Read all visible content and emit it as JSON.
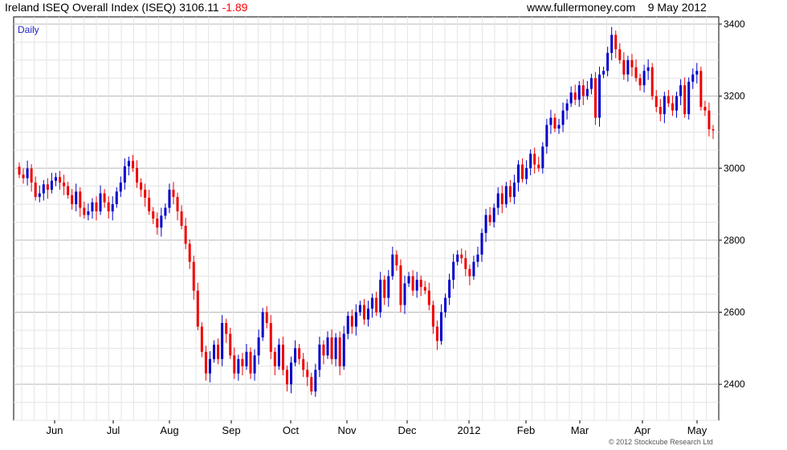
{
  "header": {
    "title": "Ireland ISEQ Overall Index (ISEQ)",
    "last": "3106.11",
    "change": "-1.89",
    "site": "www.fullermoney.com",
    "date": "9 May 2012"
  },
  "period_label": "Daily",
  "credit": "© 2012 Stockcube Research Ltd",
  "colors": {
    "up": "#0000cc",
    "down": "#ee0000",
    "grid": "#cfcfcf",
    "axis": "#000000"
  },
  "chart_data": {
    "type": "candlestick",
    "title": "Ireland ISEQ Overall Index (ISEQ)",
    "x_ticks": [
      "Jun",
      "Jul",
      "Aug",
      "Sep",
      "Oct",
      "Nov",
      "Dec",
      "2012",
      "Feb",
      "Mar",
      "Apr",
      "May"
    ],
    "y_ticks": [
      2400,
      2600,
      2800,
      3000,
      3200,
      3400
    ],
    "ylim": [
      2300,
      3420
    ],
    "grid": true,
    "series": [
      {
        "name": "ISEQ",
        "open_close": [
          [
            3004,
            2982
          ],
          [
            2982,
            2972
          ],
          [
            2972,
            2999
          ],
          [
            2999,
            2960
          ],
          [
            2960,
            2920
          ],
          [
            2920,
            2930
          ],
          [
            2930,
            2955
          ],
          [
            2955,
            2940
          ],
          [
            2940,
            2965
          ],
          [
            2965,
            2975
          ],
          [
            2975,
            2960
          ],
          [
            2960,
            2950
          ],
          [
            2950,
            2925
          ],
          [
            2925,
            2900
          ],
          [
            2900,
            2935
          ],
          [
            2935,
            2890
          ],
          [
            2890,
            2870
          ],
          [
            2870,
            2880
          ],
          [
            2880,
            2905
          ],
          [
            2905,
            2880
          ],
          [
            2880,
            2930
          ],
          [
            2930,
            2905
          ],
          [
            2905,
            2880
          ],
          [
            2880,
            2900
          ],
          [
            2900,
            2935
          ],
          [
            2935,
            2960
          ],
          [
            2960,
            3005
          ],
          [
            3005,
            3020
          ],
          [
            3020,
            3000
          ],
          [
            3000,
            2960
          ],
          [
            2960,
            2940
          ],
          [
            2940,
            2918
          ],
          [
            2918,
            2880
          ],
          [
            2880,
            2860
          ],
          [
            2860,
            2835
          ],
          [
            2835,
            2868
          ],
          [
            2868,
            2890
          ],
          [
            2890,
            2940
          ],
          [
            2940,
            2920
          ],
          [
            2920,
            2880
          ],
          [
            2880,
            2840
          ],
          [
            2840,
            2790
          ],
          [
            2790,
            2740
          ],
          [
            2740,
            2660
          ],
          [
            2660,
            2560
          ],
          [
            2560,
            2490
          ],
          [
            2490,
            2430
          ],
          [
            2430,
            2470
          ],
          [
            2470,
            2510
          ],
          [
            2510,
            2470
          ],
          [
            2470,
            2570
          ],
          [
            2570,
            2540
          ],
          [
            2540,
            2480
          ],
          [
            2480,
            2430
          ],
          [
            2430,
            2470
          ],
          [
            2470,
            2450
          ],
          [
            2450,
            2490
          ],
          [
            2490,
            2430
          ],
          [
            2430,
            2480
          ],
          [
            2480,
            2530
          ],
          [
            2530,
            2600
          ],
          [
            2600,
            2570
          ],
          [
            2570,
            2490
          ],
          [
            2490,
            2450
          ],
          [
            2450,
            2510
          ],
          [
            2510,
            2440
          ],
          [
            2440,
            2400
          ],
          [
            2400,
            2460
          ],
          [
            2460,
            2500
          ],
          [
            2500,
            2470
          ],
          [
            2470,
            2440
          ],
          [
            2440,
            2420
          ],
          [
            2420,
            2380
          ],
          [
            2380,
            2440
          ],
          [
            2440,
            2510
          ],
          [
            2510,
            2480
          ],
          [
            2480,
            2530
          ],
          [
            2530,
            2470
          ],
          [
            2470,
            2530
          ],
          [
            2530,
            2450
          ],
          [
            2450,
            2540
          ],
          [
            2540,
            2590
          ],
          [
            2590,
            2560
          ],
          [
            2560,
            2600
          ],
          [
            2600,
            2620
          ],
          [
            2620,
            2580
          ],
          [
            2580,
            2610
          ],
          [
            2610,
            2640
          ],
          [
            2640,
            2600
          ],
          [
            2600,
            2690
          ],
          [
            2690,
            2640
          ],
          [
            2640,
            2700
          ],
          [
            2700,
            2760
          ],
          [
            2760,
            2730
          ],
          [
            2730,
            2620
          ],
          [
            2620,
            2680
          ],
          [
            2680,
            2700
          ],
          [
            2700,
            2660
          ],
          [
            2660,
            2690
          ],
          [
            2690,
            2670
          ],
          [
            2670,
            2660
          ],
          [
            2660,
            2620
          ],
          [
            2620,
            2560
          ],
          [
            2560,
            2520
          ],
          [
            2520,
            2600
          ],
          [
            2600,
            2640
          ],
          [
            2640,
            2690
          ],
          [
            2690,
            2740
          ],
          [
            2740,
            2760
          ],
          [
            2760,
            2750
          ],
          [
            2750,
            2720
          ],
          [
            2720,
            2700
          ],
          [
            2700,
            2740
          ],
          [
            2740,
            2760
          ],
          [
            2760,
            2820
          ],
          [
            2820,
            2870
          ],
          [
            2870,
            2850
          ],
          [
            2850,
            2890
          ],
          [
            2890,
            2930
          ],
          [
            2930,
            2900
          ],
          [
            2900,
            2950
          ],
          [
            2950,
            2920
          ],
          [
            2920,
            2960
          ],
          [
            2960,
            3010
          ],
          [
            3010,
            2970
          ],
          [
            2970,
            3000
          ],
          [
            3000,
            3040
          ],
          [
            3040,
            3010
          ],
          [
            3010,
            3000
          ],
          [
            3000,
            3060
          ],
          [
            3060,
            3120
          ],
          [
            3120,
            3140
          ],
          [
            3140,
            3110
          ],
          [
            3110,
            3120
          ],
          [
            3120,
            3160
          ],
          [
            3160,
            3180
          ],
          [
            3180,
            3210
          ],
          [
            3210,
            3190
          ],
          [
            3190,
            3230
          ],
          [
            3230,
            3200
          ],
          [
            3200,
            3220
          ],
          [
            3220,
            3250
          ],
          [
            3250,
            3140
          ],
          [
            3140,
            3260
          ],
          [
            3260,
            3270
          ],
          [
            3270,
            3320
          ],
          [
            3320,
            3370
          ],
          [
            3370,
            3330
          ],
          [
            3330,
            3300
          ],
          [
            3300,
            3260
          ],
          [
            3260,
            3300
          ],
          [
            3300,
            3280
          ],
          [
            3280,
            3250
          ],
          [
            3250,
            3230
          ],
          [
            3230,
            3270
          ],
          [
            3270,
            3280
          ],
          [
            3280,
            3200
          ],
          [
            3200,
            3170
          ],
          [
            3170,
            3150
          ],
          [
            3150,
            3200
          ],
          [
            3200,
            3180
          ],
          [
            3180,
            3160
          ],
          [
            3160,
            3200
          ],
          [
            3200,
            3230
          ],
          [
            3230,
            3150
          ],
          [
            3150,
            3240
          ],
          [
            3240,
            3260
          ],
          [
            3260,
            3270
          ],
          [
            3270,
            3170
          ],
          [
            3170,
            3160
          ],
          [
            3160,
            3108
          ],
          [
            3108,
            3106
          ]
        ]
      }
    ]
  }
}
